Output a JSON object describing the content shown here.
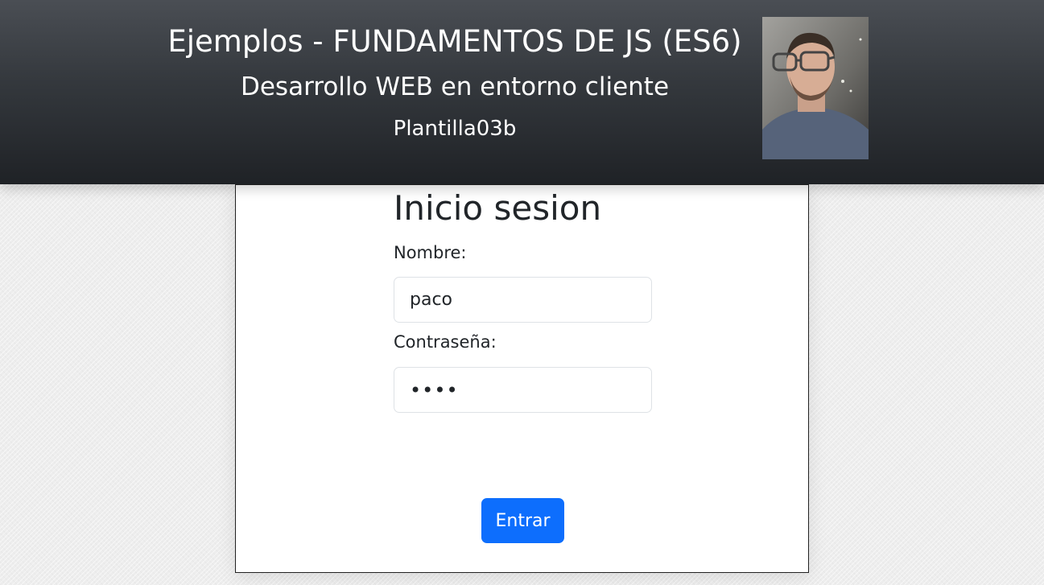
{
  "header": {
    "title": "Ejemplos - FUNDAMENTOS DE JS (ES6)",
    "subtitle": "Desarrollo WEB en entorno cliente",
    "template_name": "Plantilla03b"
  },
  "login_form": {
    "title": "Inicio sesion",
    "name_label": "Nombre:",
    "name_value": "paco",
    "password_label": "Contraseña:",
    "password_value": "pass",
    "submit_label": "Entrar"
  },
  "colors": {
    "header_dark": "#1f2226",
    "button_primary": "#0d6efd",
    "card_background": "#ffffff"
  }
}
